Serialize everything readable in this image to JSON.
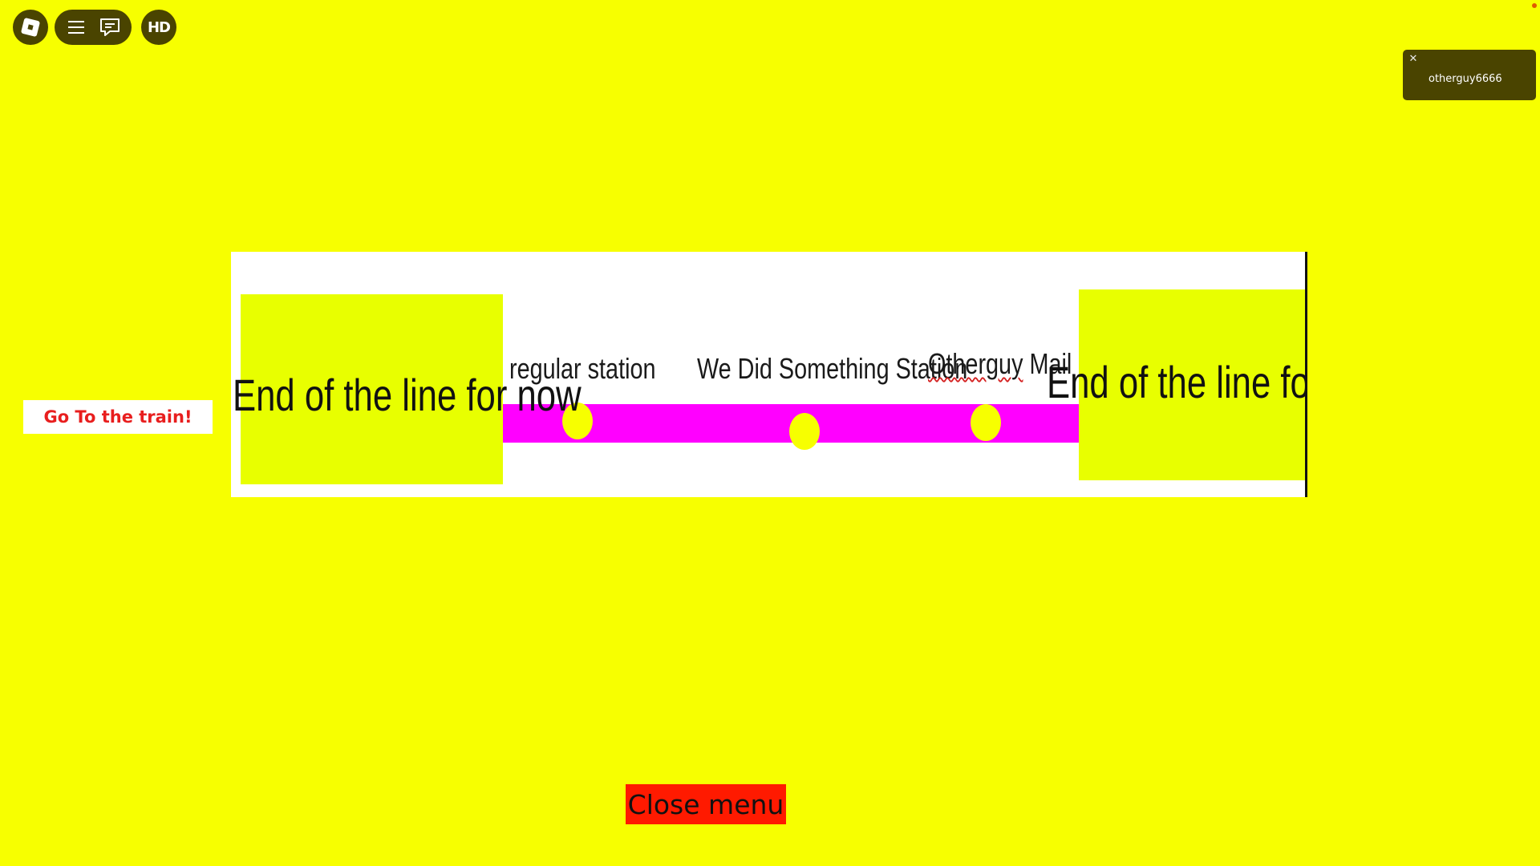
{
  "topbar": {
    "roblox_icon": "roblox-logo-icon",
    "menu_icon": "hamburger-menu-icon",
    "chat_icon": "chat-bubble-icon",
    "hd_label": "HD"
  },
  "notification": {
    "close_glyph": "✕",
    "username": "otherguy6666"
  },
  "go_train_label": "Go To the train!",
  "map": {
    "end_left": "End of the line for now",
    "end_right": "End of the line for now",
    "stations": [
      {
        "name": "regular station"
      },
      {
        "name": "We Did Something Station"
      },
      {
        "name_part1": "Otherguy",
        "name_part2": " Mail"
      }
    ]
  },
  "close_menu_label": "Close menu",
  "colors": {
    "background": "#f7ff00",
    "line": "#ff00ff",
    "end_box": "#e8ff00",
    "close_button": "#ff1a00",
    "go_train_text": "#e81e1e",
    "ui_dark": "#4a4400"
  }
}
